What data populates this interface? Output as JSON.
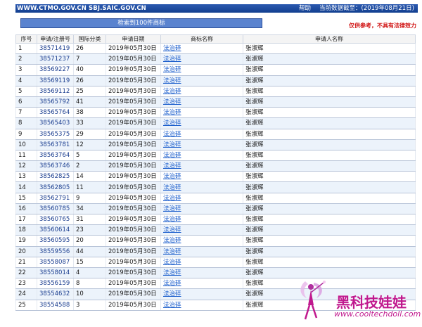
{
  "header": {
    "site": "WWW.CTMO.GOV.CN SBJ.SAIC.GOV.CN",
    "help": "帮助",
    "update": "当前数据截至：(2019年08月21日)"
  },
  "result_banner": "检索到100件商标",
  "disclaimer": "仅供参考，不具有法律效力",
  "table": {
    "headers": [
      "序号",
      "申请/注册号",
      "国际分类",
      "申请日期",
      "商标名称",
      "申请人名称"
    ],
    "rows": [
      [
        "1",
        "38571419",
        "26",
        "2019年05月30日",
        "法治碎",
        "张淑辉"
      ],
      [
        "2",
        "38571237",
        "7",
        "2019年05月30日",
        "法治碎",
        "张淑辉"
      ],
      [
        "3",
        "38569227",
        "40",
        "2019年05月30日",
        "法治碎",
        "张淑辉"
      ],
      [
        "4",
        "38569119",
        "26",
        "2019年05月30日",
        "法治碎",
        "张淑辉"
      ],
      [
        "5",
        "38569112",
        "25",
        "2019年05月30日",
        "法治碎",
        "张淑辉"
      ],
      [
        "6",
        "38565792",
        "41",
        "2019年05月30日",
        "法治碎",
        "张淑辉"
      ],
      [
        "7",
        "38565764",
        "38",
        "2019年05月30日",
        "法治碎",
        "张淑辉"
      ],
      [
        "8",
        "38565403",
        "33",
        "2019年05月30日",
        "法治碎",
        "张淑辉"
      ],
      [
        "9",
        "38565375",
        "29",
        "2019年05月30日",
        "法治碎",
        "张淑辉"
      ],
      [
        "10",
        "38563781",
        "12",
        "2019年05月30日",
        "法治碎",
        "张淑辉"
      ],
      [
        "11",
        "38563764",
        "5",
        "2019年05月30日",
        "法治碎",
        "张淑辉"
      ],
      [
        "12",
        "38563746",
        "2",
        "2019年05月30日",
        "法治碎",
        "张淑辉"
      ],
      [
        "13",
        "38562825",
        "14",
        "2019年05月30日",
        "法治碎",
        "张淑辉"
      ],
      [
        "14",
        "38562805",
        "11",
        "2019年05月30日",
        "法治碎",
        "张淑辉"
      ],
      [
        "15",
        "38562791",
        "9",
        "2019年05月30日",
        "法治碎",
        "张淑辉"
      ],
      [
        "16",
        "38560785",
        "34",
        "2019年05月30日",
        "法治碎",
        "张淑辉"
      ],
      [
        "17",
        "38560765",
        "31",
        "2019年05月30日",
        "法治碎",
        "张淑辉"
      ],
      [
        "18",
        "38560614",
        "23",
        "2019年05月30日",
        "法治碎",
        "张淑辉"
      ],
      [
        "19",
        "38560595",
        "20",
        "2019年05月30日",
        "法治碎",
        "张淑辉"
      ],
      [
        "20",
        "38559556",
        "44",
        "2019年05月30日",
        "法治碎",
        "张淑辉"
      ],
      [
        "21",
        "38558087",
        "15",
        "2019年05月30日",
        "法治碎",
        "张淑辉"
      ],
      [
        "22",
        "38558014",
        "4",
        "2019年05月30日",
        "法治碎",
        "张淑辉"
      ],
      [
        "23",
        "38556159",
        "8",
        "2019年05月30日",
        "法治碎",
        "张淑辉"
      ],
      [
        "24",
        "38554632",
        "10",
        "2019年05月30日",
        "法治碎",
        "张淑辉"
      ],
      [
        "25",
        "38554588",
        "3",
        "2019年05月30日",
        "法治碎",
        "张淑辉"
      ]
    ]
  },
  "watermark": {
    "text_cn": "黑科技娃娃",
    "url": "www.cooltechdoll.com"
  },
  "colors": {
    "header_bg": "#1e4d9e",
    "banner_bg": "#5a83cf",
    "row_alt": "#ecf3fb",
    "link": "#1a5dcc",
    "disclaimer": "#d01010",
    "watermark": "#c0198e"
  }
}
